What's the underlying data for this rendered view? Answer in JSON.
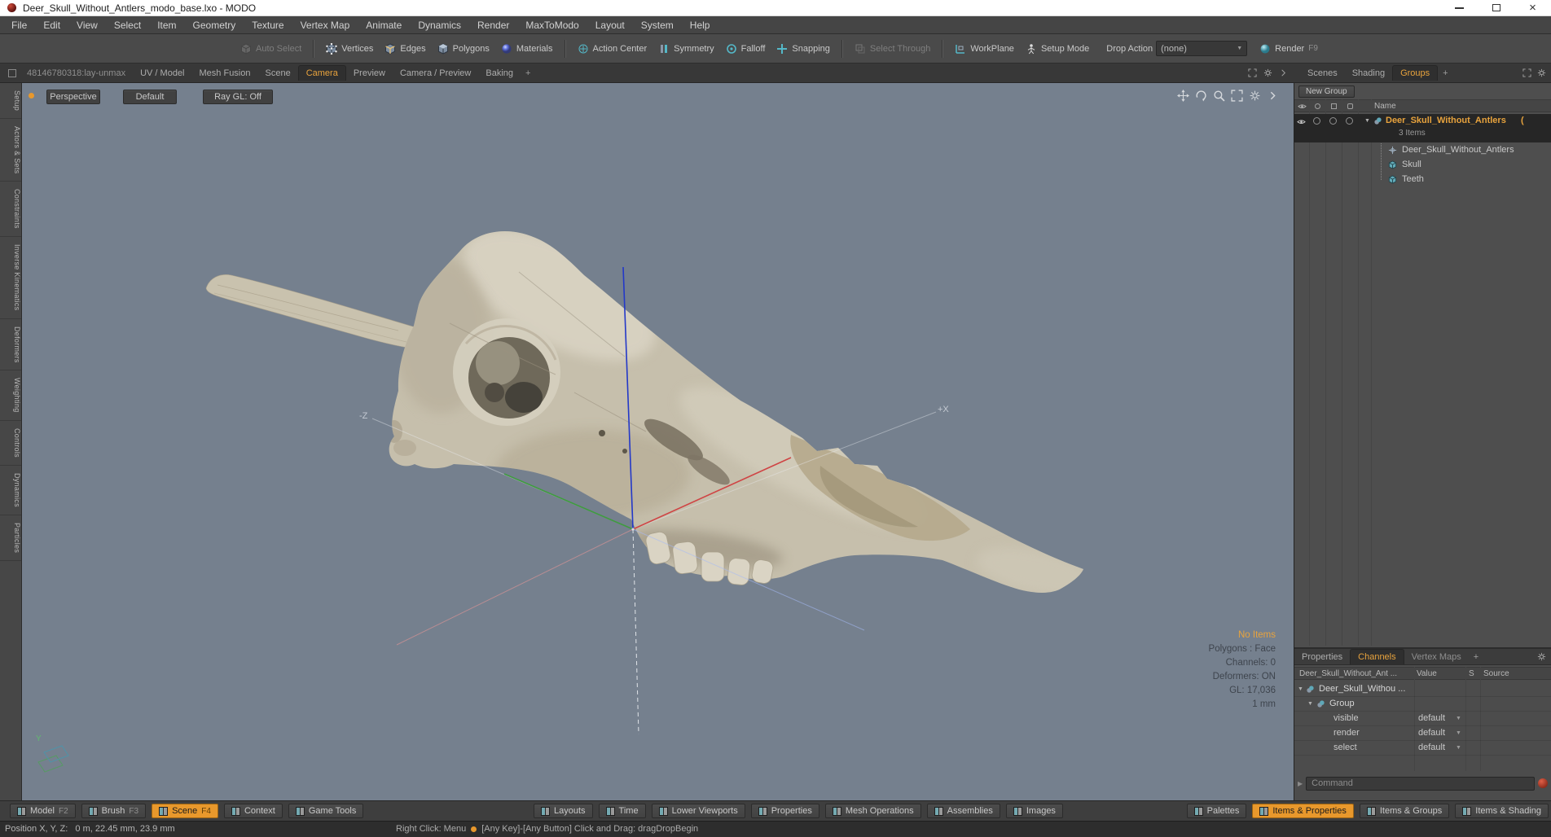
{
  "titlebar": {
    "title": "Deer_Skull_Without_Antlers_modo_base.lxo - MODO"
  },
  "menubar": {
    "items": [
      "File",
      "Edit",
      "View",
      "Select",
      "Item",
      "Geometry",
      "Texture",
      "Vertex Map",
      "Animate",
      "Dynamics",
      "Render",
      "MaxToModo",
      "Layout",
      "System",
      "Help"
    ]
  },
  "toolbar": {
    "auto_select": "Auto Select",
    "vertices": "Vertices",
    "edges": "Edges",
    "polygons": "Polygons",
    "materials": "Materials",
    "action_center": "Action Center",
    "symmetry": "Symmetry",
    "falloff": "Falloff",
    "snapping": "Snapping",
    "select_through": "Select Through",
    "workplane": "WorkPlane",
    "setup_mode": "Setup Mode",
    "drop_action_label": "Drop Action",
    "drop_action_value": "(none)",
    "render_label": "Render",
    "render_key": "F9"
  },
  "tabstrip": {
    "session": "48146780318:lay-unmax",
    "tabs": [
      "UV / Model",
      "Mesh Fusion",
      "Scene",
      "Camera",
      "Preview",
      "Camera / Preview",
      "Baking"
    ],
    "add": "+"
  },
  "left_rail": {
    "items": [
      "Setup",
      "Actors & Sets",
      "Constraints",
      "Inverse Kinematics",
      "Deformers",
      "Weighting",
      "Controls",
      "Dynamics",
      "Particles"
    ]
  },
  "viewport": {
    "camera": "Perspective",
    "shading": "Default",
    "raygl": "Ray GL: Off",
    "label_pos_x": "+X",
    "label_neg_z": "-Z",
    "label_y": "Y",
    "info_no_items": "No Items",
    "info_polygons": "Polygons : Face",
    "info_channels": "Channels: 0",
    "info_deformers": "Deformers: ON",
    "info_gl": "GL: 17,036",
    "info_scale": "1 mm"
  },
  "groups_panel": {
    "tabs": [
      "Scenes",
      "Shading",
      "Groups"
    ],
    "add": "+",
    "new_group_button": "New Group",
    "name_header": "Name",
    "selected_group": {
      "label": "Deer_Skull_Without_Antlers",
      "suffix": "(",
      "sub": "3 Items"
    },
    "children": [
      "Deer_Skull_Without_Antlers",
      "Skull",
      "Teeth"
    ]
  },
  "channels_panel": {
    "tabs": [
      "Properties",
      "Channels",
      "Vertex Maps"
    ],
    "add": "+",
    "headers": [
      "Deer_Skull_Without_Ant ...",
      "Value",
      "S",
      "Source"
    ],
    "group_rows": [
      "Deer_Skull_Withou ...",
      "Group"
    ],
    "channel_rows": [
      {
        "name": "visible",
        "value": "default"
      },
      {
        "name": "render",
        "value": "default"
      },
      {
        "name": "select",
        "value": "default"
      }
    ],
    "command_placeholder": "Command"
  },
  "bottombar": {
    "left": [
      {
        "label": "Model",
        "key": "F2"
      },
      {
        "label": "Brush",
        "key": "F3"
      },
      {
        "label": "Scene",
        "key": "F4"
      },
      {
        "label": "Context",
        "key": ""
      },
      {
        "label": "Game Tools",
        "key": ""
      }
    ],
    "middle": [
      "Layouts",
      "Time",
      "Lower Viewports",
      "Properties",
      "Mesh Operations",
      "Assemblies",
      "Images"
    ],
    "right": [
      "Palettes",
      "Items & Properties",
      "Items & Groups",
      "Items & Shading"
    ]
  },
  "statusbar": {
    "position": "Position X, Y, Z:   0 m, 22.45 mm, 23.9 mm",
    "hint_menu": "Right Click: Menu",
    "hint_drag": "[Any Key]-[Any Button] Click and Drag: dragDropBegin"
  }
}
